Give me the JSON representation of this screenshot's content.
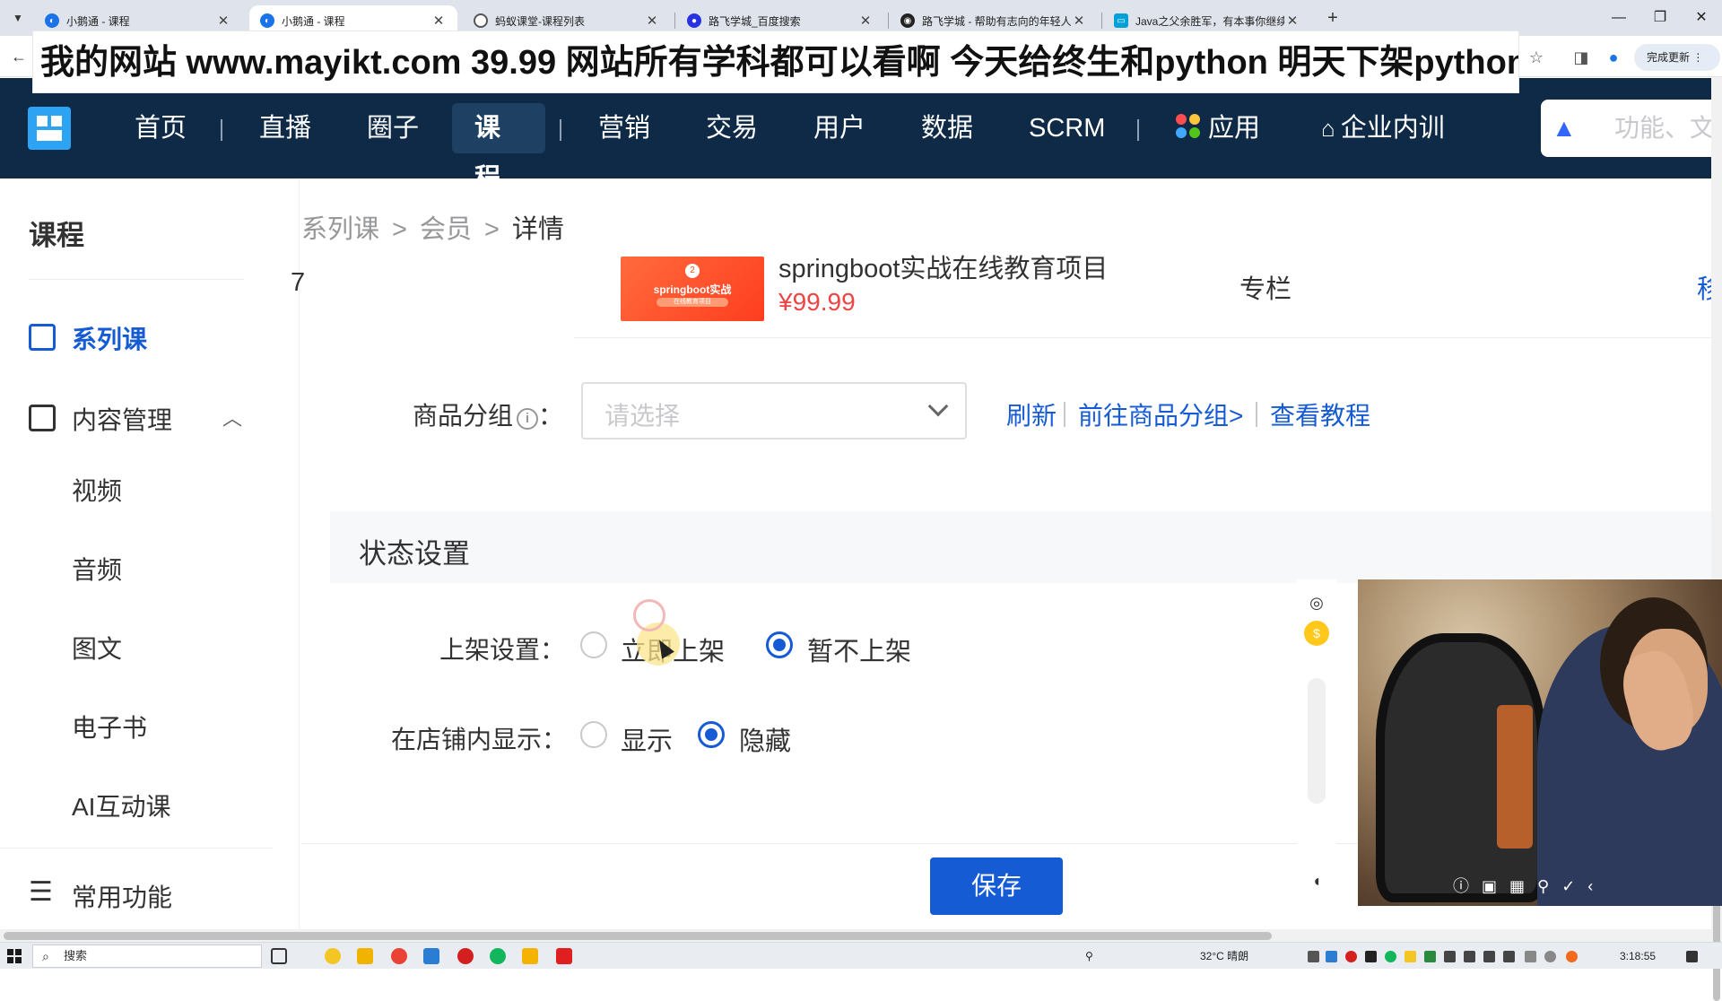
{
  "browser": {
    "tabs": [
      {
        "title": "小鹅通 - 课程",
        "active": false
      },
      {
        "title": "小鹅通 - 课程",
        "active": true
      },
      {
        "title": "蚂蚁课堂-课程列表",
        "active": false
      },
      {
        "title": "路飞学城_百度搜索",
        "active": false
      },
      {
        "title": "路飞学城 - 帮助有志向的年轻人",
        "active": false
      },
      {
        "title": "Java之父余胜军，有本事你继续",
        "active": false
      }
    ],
    "new_tab": "+",
    "update_button": "完成更新",
    "window_controls": {
      "minimize": "—",
      "restore": "❐",
      "close": "✕"
    }
  },
  "banner": {
    "text": "我的网站 www.mayikt.com 39.99 网站所有学科都可以看啊 今天给终生和python 明天下架python吧"
  },
  "topnav": {
    "items": [
      {
        "label": "首页"
      },
      {
        "label": "直播"
      },
      {
        "label": "圈子"
      },
      {
        "label": "课程",
        "active": true
      },
      {
        "label": "营销"
      },
      {
        "label": "交易"
      },
      {
        "label": "用户"
      },
      {
        "label": "数据"
      },
      {
        "label": "SCRM"
      },
      {
        "label": "应用"
      },
      {
        "label": "企业内训"
      }
    ],
    "search_placeholder": "功能、文"
  },
  "sidebar": {
    "title": "课程",
    "series": "系列课",
    "content_mgmt": "内容管理",
    "sub_items": [
      "视频",
      "音频",
      "图文",
      "电子书",
      "AI互动课"
    ],
    "common_functions": "常用功能"
  },
  "breadcrumb": [
    "系列课",
    "会员",
    "详情"
  ],
  "course_row": {
    "index": "7",
    "thumb_text": "springboot实战",
    "thumb_badge": "2",
    "thumb_sub": "在线教育项目",
    "title": "springboot实战在线教育项目",
    "price": "¥99.99",
    "type": "专栏",
    "action": "移"
  },
  "product_group": {
    "label": "商品分组",
    "info": "i",
    "colon": "：",
    "placeholder": "请选择",
    "links": [
      "刷新",
      "前往商品分组>",
      "查看教程"
    ]
  },
  "status_section": {
    "heading": "状态设置",
    "listing": {
      "label": "上架设置：",
      "options": [
        "立即上架",
        "暂不上架"
      ],
      "selected": "暂不上架"
    },
    "store_display": {
      "label": "在店铺内显示：",
      "options": [
        "显示",
        "隐藏"
      ],
      "selected": "隐藏"
    }
  },
  "save_button": "保存",
  "taskbar": {
    "search": "搜索",
    "weather": "32°C 晴朗",
    "time": "3:18:55"
  },
  "colors": {
    "primary": "#155bd4",
    "nav_bg": "#0f2a47",
    "price": "#ee4444"
  }
}
